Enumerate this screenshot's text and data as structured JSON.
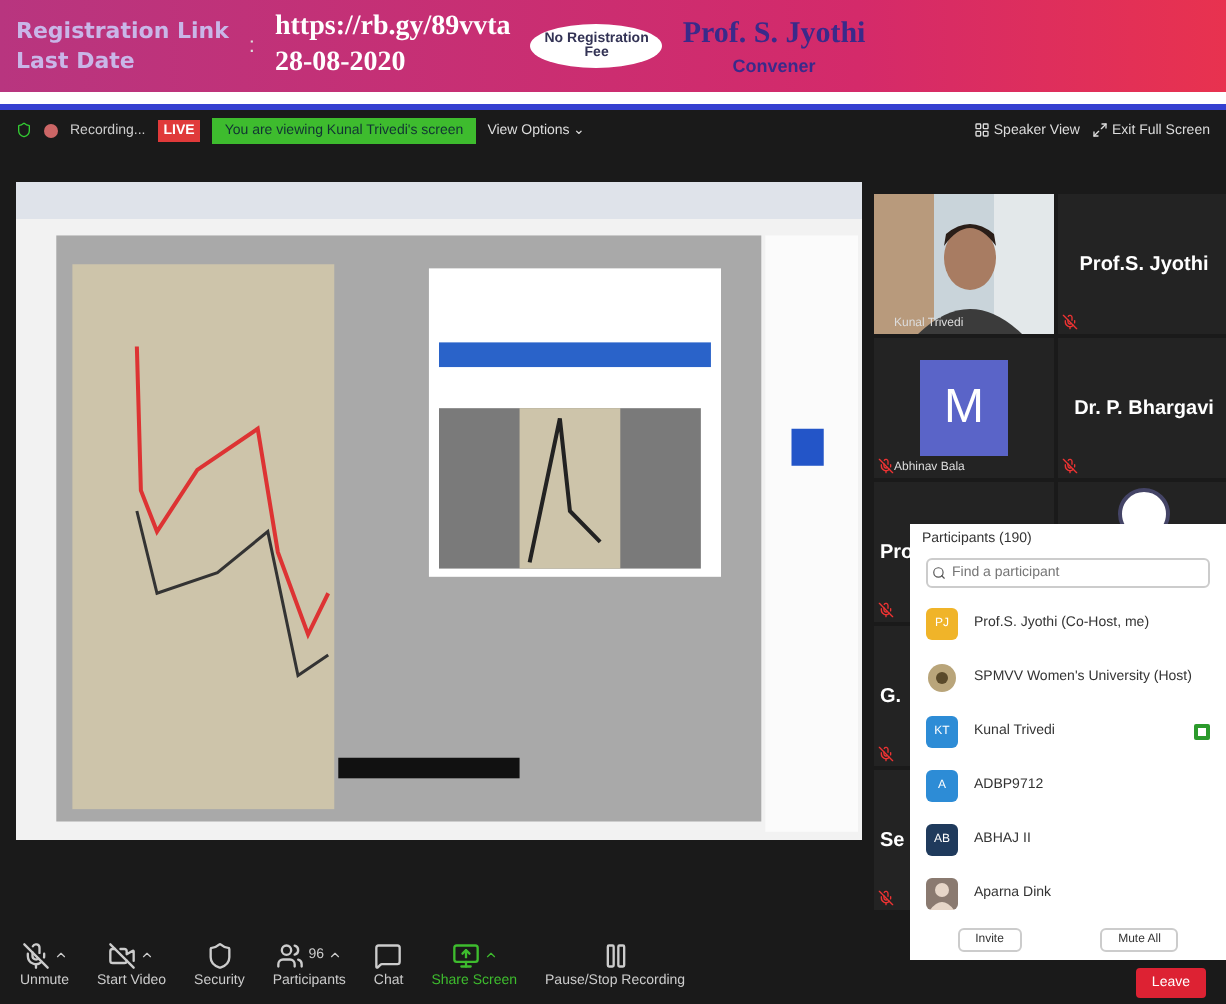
{
  "banner": {
    "separator": ":",
    "labels": [
      "Registration Link",
      "Last Date"
    ],
    "values": [
      "https://rb.gy/89vvta",
      "28-08-2020"
    ],
    "badge": "No Registration Fee",
    "name": "Prof. S. Jyothi",
    "role": "Convener"
  },
  "meeting_bar": {
    "recording": "Recording...",
    "live": "LIVE",
    "notice": "You are viewing Kunal Trivedi's screen",
    "view_options": "View Options ⌄",
    "buttons": [
      "Speaker View",
      "Exit Full Screen"
    ]
  },
  "tiles": [
    {
      "kind": "video",
      "name": "Kunal Trivedi",
      "muted": false
    },
    {
      "kind": "name",
      "name": "Prof.S. Jyothi",
      "muted": true
    },
    {
      "kind": "avatar",
      "initial": "M",
      "name": "Abhinav Bala",
      "muted": true
    },
    {
      "kind": "name",
      "name": "Dr. P. Bhargavi",
      "muted": true
    },
    {
      "kind": "name",
      "name": "Pro",
      "muted": true
    },
    {
      "kind": "logo",
      "muted": false
    },
    {
      "kind": "name",
      "name": "G.",
      "muted": true
    },
    {
      "kind": "name",
      "name": "Se",
      "muted": true
    }
  ],
  "participants": {
    "title": "Participants (190)",
    "search": {
      "placeholder": "Find a participant"
    },
    "rows": [
      {
        "kind": "initials",
        "initials": "PJ",
        "color": "#f0b429",
        "name": "Prof.S. Jyothi (Co-Host, me)",
        "video": false
      },
      {
        "kind": "logo",
        "name": "SPMVV Women's University (Host)",
        "video": false
      },
      {
        "kind": "initials",
        "initials": "KT",
        "color": "#2d8cd6",
        "name": "Kunal Trivedi",
        "video": true
      },
      {
        "kind": "initials",
        "initials": "A",
        "color": "#2d8cd6",
        "name": "ADBP9712",
        "video": false
      },
      {
        "kind": "initials",
        "initials": "AB",
        "color": "#1f3a5c",
        "name": "ABHAJ II",
        "video": false
      },
      {
        "name": "Aparna Dink",
        "video": false
      }
    ],
    "buttons": [
      "Invite",
      "Mute All"
    ]
  },
  "toolbar": [
    {
      "kind": "mic",
      "label": "Unmute"
    },
    {
      "kind": "video",
      "label": "Start Video"
    },
    {
      "kind": "security",
      "label": "Security"
    },
    {
      "kind": "participants",
      "label": "Participants",
      "count": "96"
    },
    {
      "kind": "chat",
      "label": "Chat"
    },
    {
      "kind": "share",
      "label": "Share Screen"
    },
    {
      "kind": "record",
      "label": "Pause/Stop Recording"
    }
  ],
  "leave": "Leave"
}
